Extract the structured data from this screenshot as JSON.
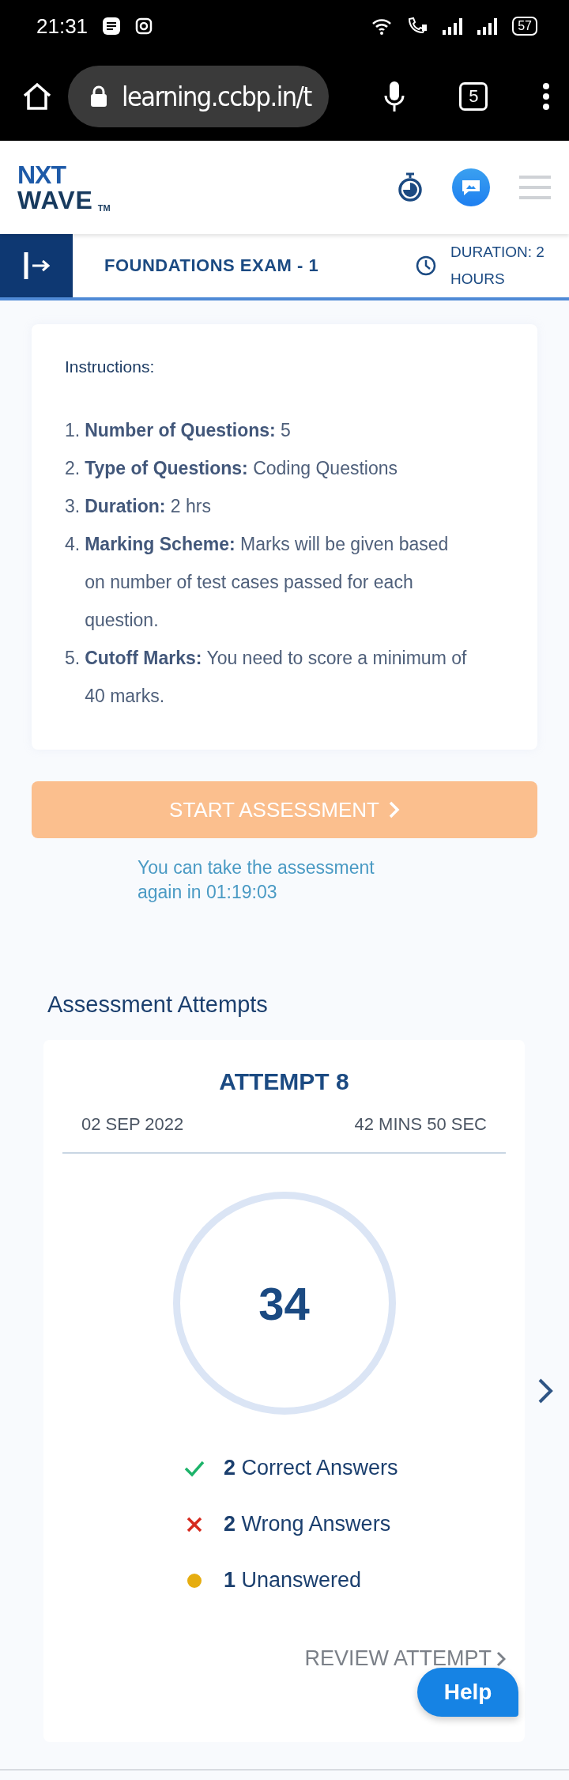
{
  "status_bar": {
    "time": "21:31",
    "battery": "57"
  },
  "browser": {
    "url": "learning.ccbp.in/t",
    "tab_count": "5"
  },
  "header": {
    "logo": {
      "line_1": "NXT",
      "line_2": "WAVE",
      "mark": "TM"
    }
  },
  "exam_bar": {
    "title": "FOUNDATIONS EXAM - 1",
    "duration": "DURATION: 2 HOURS"
  },
  "instructions": {
    "heading": "Instructions:",
    "items": [
      {
        "number": "1.",
        "text": "**Number of Questions:** 5"
      },
      {
        "number": "2.",
        "text": "**Type of Questions:** Coding Questions"
      },
      {
        "number": "3.",
        "text": "**Duration:** 2 hrs"
      },
      {
        "number": "4.",
        "text": "**Marking Scheme:** Marks will be given based on number of test cases passed for each question."
      },
      {
        "number": "5.",
        "text": "**Cutoff Marks:** You need to score a minimum of 40 marks."
      }
    ]
  },
  "start_button": {
    "label": "START ASSESSMENT",
    "disabled": true
  },
  "retake_note": "You can take the assessment again in 01:19:03",
  "attempts": {
    "heading": "Assessment Attempts",
    "items": [
      {
        "title": "ATTEMPT 8",
        "date": "02 SEP 2022",
        "time_taken": "42 MINS 50 SEC",
        "score": "34",
        "results": [
          {
            "kind": "correct",
            "count": "2",
            "label": "Correct Answers"
          },
          {
            "kind": "wrong",
            "count": "2",
            "label": "Wrong Answers"
          },
          {
            "kind": "unanswered",
            "count": "1",
            "label": "Unanswered"
          }
        ],
        "review": "REVIEW ATTEMPT"
      }
    ]
  },
  "help_button": "Help"
}
